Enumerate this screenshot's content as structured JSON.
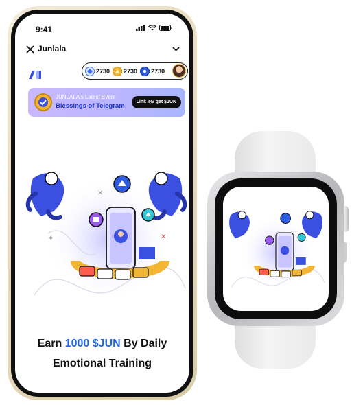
{
  "status": {
    "time": "9:41"
  },
  "nav": {
    "title": "Junlala"
  },
  "balances": [
    {
      "icon": "diamond-coin-icon",
      "value": "2730",
      "color": "#3b6cf2"
    },
    {
      "icon": "gold-coin-icon",
      "value": "2730",
      "color": "#f2b534"
    },
    {
      "icon": "jun-coin-icon",
      "value": "2730",
      "color": "#2f5be0"
    }
  ],
  "banner": {
    "subtitle": "JUNLALA's Latest Event",
    "title": "Blessings of Telegram",
    "button": "Link TG get $JUN"
  },
  "headline": {
    "prefix": "Earn ",
    "highlight": "1000 $JUN",
    "suffix": " By Daily",
    "line2": "Emotional Training"
  },
  "colors": {
    "accent": "#1e66e8",
    "brand_blue": "#3b4fe0"
  }
}
